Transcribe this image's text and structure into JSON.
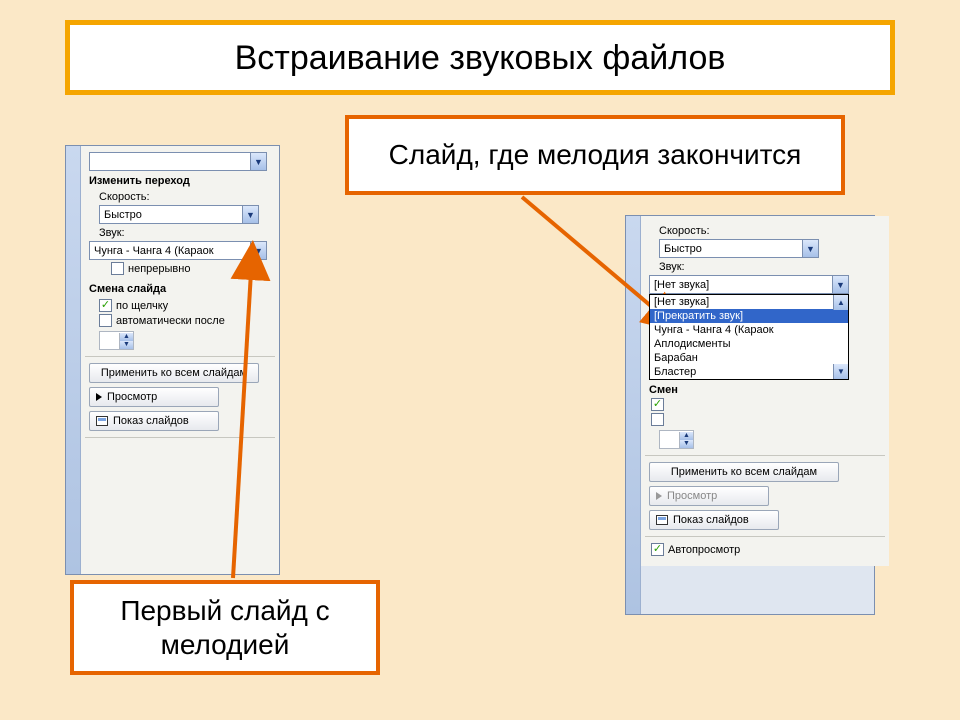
{
  "title": "Встраивание звуковых файлов",
  "callout_top": "Слайд, где мелодия закончится",
  "callout_bottom": "Первый слайд с мелодией",
  "left_panel": {
    "section_transition": "Изменить переход",
    "speed_label": "Скорость:",
    "speed_value": "Быстро",
    "sound_label": "Звук:",
    "sound_value": "Чунга - Чанга 4 (Караок",
    "loop_label": "непрерывно",
    "section_advance": "Смена слайда",
    "on_click": "по щелчку",
    "auto_after": "автоматически после",
    "apply_all": "Применить ко всем слайдам",
    "preview": "Просмотр",
    "slideshow": "Показ слайдов"
  },
  "right_panel": {
    "speed_label": "Скорость:",
    "speed_value": "Быстро",
    "sound_label": "Звук:",
    "sound_value": "[Нет звука]",
    "options": [
      "[Нет звука]",
      "[Прекратить звук]",
      "Чунга - Чанга 4 (Караок",
      "Аплодисменты",
      "Барабан",
      "Бластер"
    ],
    "section_advance_short": "Смен",
    "apply_all": "Применить ко всем слайдам",
    "preview": "Просмотр",
    "slideshow": "Показ слайдов",
    "autopreview": "Автопросмотр"
  }
}
